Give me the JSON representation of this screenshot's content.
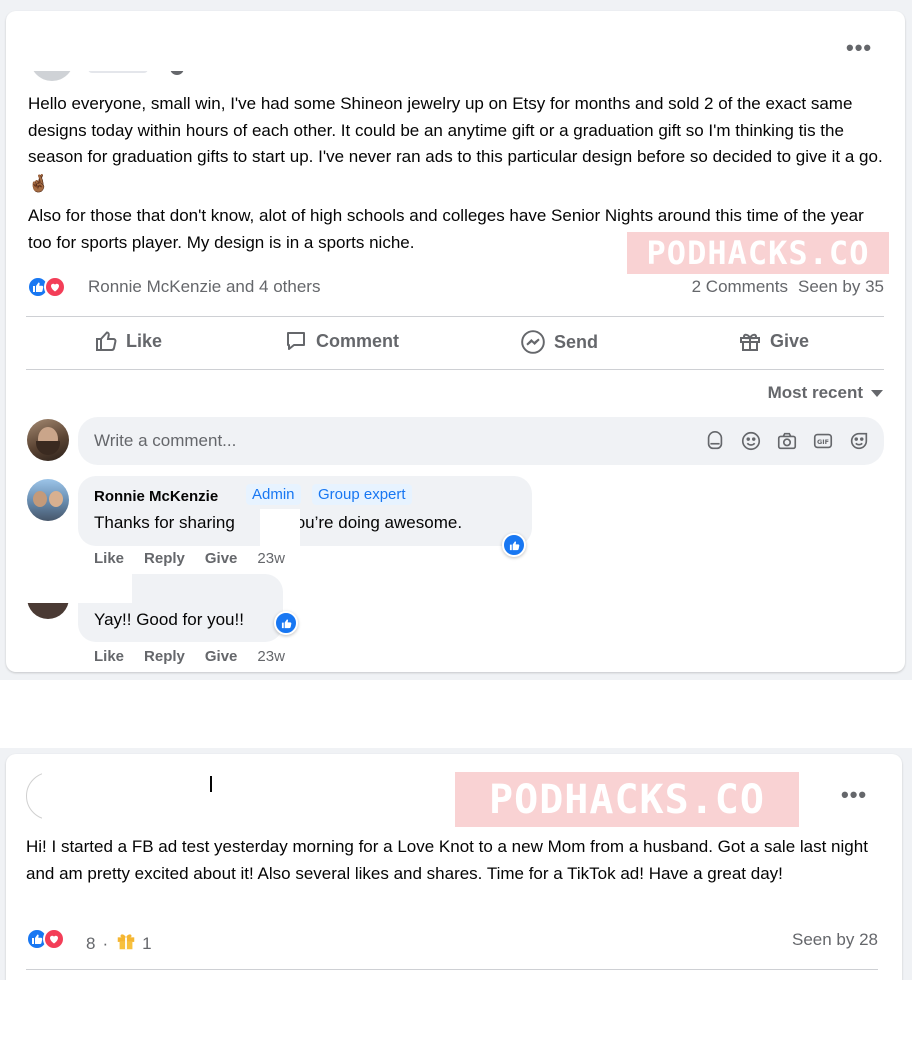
{
  "post1": {
    "paragraphs": [
      "Hello everyone,  small win, I've had some Shineon jewelry up on Etsy for months and sold 2 of the exact same designs today within hours of each other. It could be an anytime gift or a graduation gift so I'm thinking tis the season for graduation gifts to start up.  I've never ran ads to this particular design before so decided to give it a go. 🤞🏾",
      "Also for those that don't know,  alot of high schools and colleges have Senior Nights around this time of the year too for sports player. My design is in a sports niche."
    ],
    "reactions_text": "Ronnie McKenzie and 4 others",
    "comments_count": "2 Comments",
    "seen_by": "Seen by 35",
    "actions": {
      "like": "Like",
      "comment": "Comment",
      "send": "Send",
      "give": "Give"
    },
    "sort_label": "Most recent",
    "comment_placeholder": "Write a comment...",
    "comments": [
      {
        "name": "Ronnie McKenzie",
        "badges": [
          "Admin",
          "Group expert"
        ],
        "text_before": "Thanks for sharing",
        "text_after": "! You’re doing awesome.",
        "actions": [
          "Like",
          "Reply",
          "Give"
        ],
        "time": "23w"
      },
      {
        "text": "Yay!! Good for you!!",
        "actions": [
          "Like",
          "Reply",
          "Give"
        ],
        "time": "23w"
      }
    ]
  },
  "post2": {
    "text": "Hi! I started a FB ad test yesterday morning for a Love Knot to a new Mom from a husband. Got a sale last night and am pretty excited about it! Also several likes and shares. Time for a TikTok ad! Have a great day!",
    "reaction_count": "8",
    "separator": "·",
    "gift_count": "1",
    "seen_by": "Seen by 28"
  },
  "watermark": "PODHACKS.CO",
  "colors": {
    "brand_blue": "#1877f2",
    "love_red": "#f33e58",
    "muted": "#65676b",
    "background": "#f0f2f5"
  }
}
